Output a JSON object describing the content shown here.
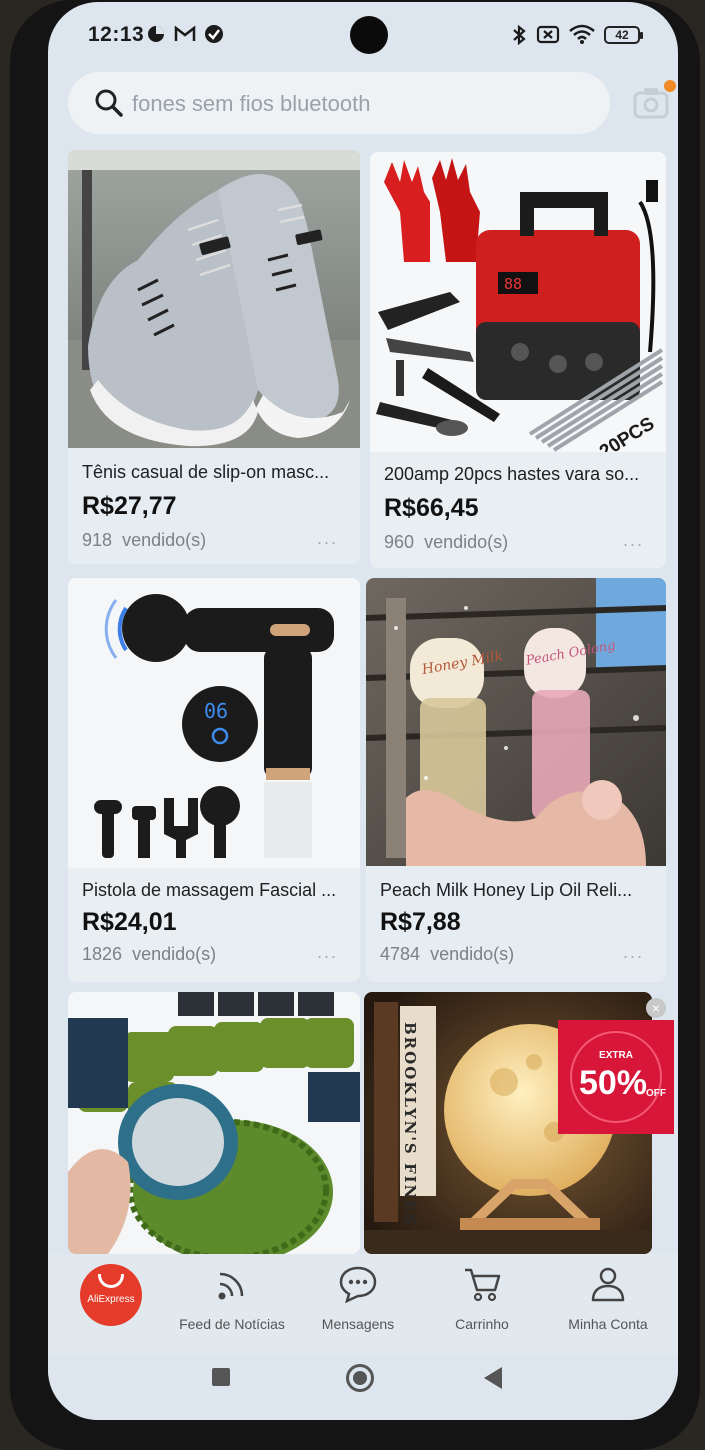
{
  "status": {
    "time": "12:13",
    "battery": "42"
  },
  "search": {
    "placeholder": "fones sem fios bluetooth"
  },
  "products": [
    {
      "title": "Tênis casual de slip-on masc...",
      "price": "R$27,77",
      "sold_count": "918",
      "sold_label": "vendido(s)",
      "more": "..."
    },
    {
      "title": "200amp 20pcs hastes vara so...",
      "price": "R$66,45",
      "sold_count": "960",
      "sold_label": "vendido(s)",
      "more": "..."
    },
    {
      "title": "Pistola de massagem Fascial ...",
      "price": "R$24,01",
      "sold_count": "1826",
      "sold_label": "vendido(s)",
      "more": "..."
    },
    {
      "title": "Peach Milk Honey Lip Oil Reli...",
      "price": "R$7,88",
      "sold_count": "4784",
      "sold_label": "vendido(s)",
      "more": "..."
    }
  ],
  "image_text": {
    "welder_pcs": "20PCS",
    "massager_display": "06",
    "lip_oil_1": "Honey Milk",
    "lip_oil_2": "Peach Oolong",
    "book_spine": "BROOKLYN'S FINEST",
    "promo_top": "EXTRA",
    "promo_main": "50%",
    "promo_bottom": "OFF"
  },
  "nav": {
    "home_logo": "AliExpress",
    "items": [
      {
        "label": "Feed de Notícias",
        "icon": "feed-icon"
      },
      {
        "label": "Mensagens",
        "icon": "chat-icon"
      },
      {
        "label": "Carrinho",
        "icon": "cart-icon"
      },
      {
        "label": "Minha Conta",
        "icon": "user-icon"
      }
    ]
  },
  "colors": {
    "accent": "#e53b2b",
    "promo": "#e0203a",
    "background": "#dde6ee"
  }
}
